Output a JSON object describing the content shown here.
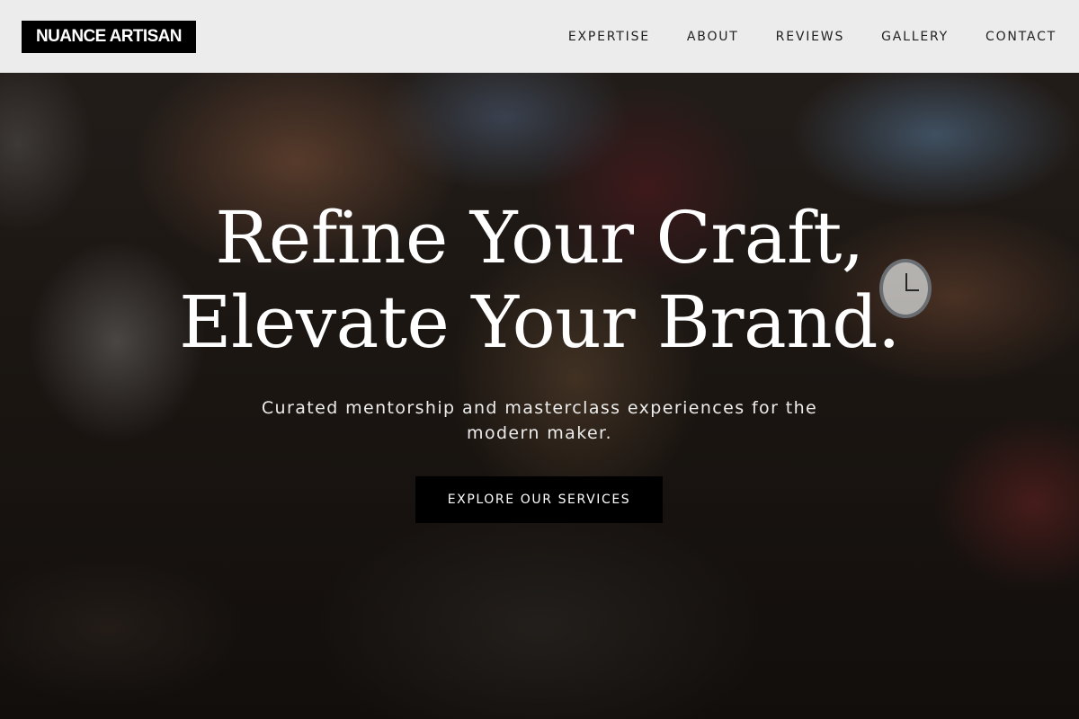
{
  "header": {
    "logo": "NUANCE ARTISAN",
    "nav": [
      {
        "label": "EXPERTISE"
      },
      {
        "label": "ABOUT"
      },
      {
        "label": "REVIEWS"
      },
      {
        "label": "GALLERY"
      },
      {
        "label": "CONTACT"
      }
    ]
  },
  "hero": {
    "headline_line1": "Refine Your Craft,",
    "headline_line2": "Elevate Your Brand.",
    "subtext": "Curated mentorship and masterclass experiences for the modern maker.",
    "cta_label": "EXPLORE OUR SERVICES"
  },
  "colors": {
    "header_bg": "#f5f5f5",
    "logo_bg": "#000000",
    "cta_bg": "#000000",
    "text_light": "#ffffff"
  }
}
